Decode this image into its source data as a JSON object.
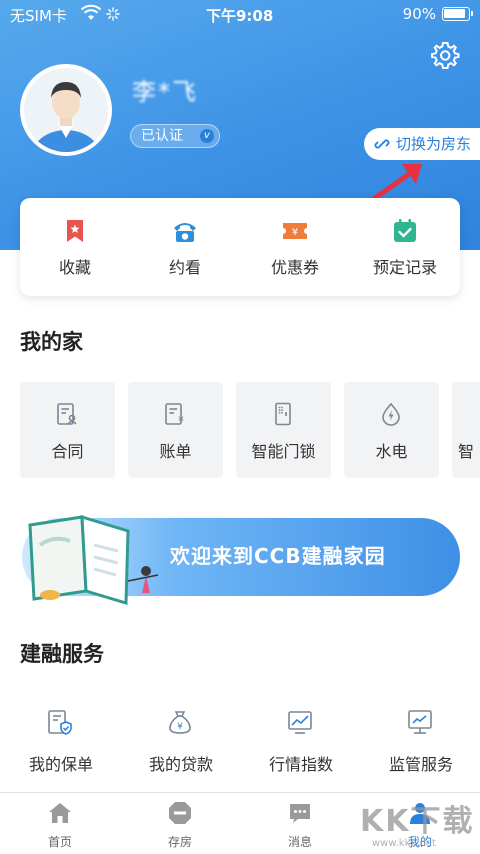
{
  "status_bar": {
    "carrier": "无SIM卡",
    "time": "下午9:08",
    "battery": "90%",
    "battery_level": 0.9
  },
  "profile": {
    "name": "李*飞",
    "verified_label": "已认证",
    "verified_badge": "v"
  },
  "switch_button": {
    "label": "切换为房东"
  },
  "quick_actions": [
    {
      "label": "收藏",
      "icon": "bookmark-icon",
      "color": "#e9544f"
    },
    {
      "label": "约看",
      "icon": "phone-icon",
      "color": "#2f8fd8"
    },
    {
      "label": "优惠券",
      "icon": "coupon-icon",
      "color": "#f07c3a"
    },
    {
      "label": "预定记录",
      "icon": "calendar-check-icon",
      "color": "#2fb58f"
    }
  ],
  "my_home": {
    "title": "我的家",
    "items": [
      {
        "label": "合同",
        "icon": "contract-icon"
      },
      {
        "label": "账单",
        "icon": "bill-icon"
      },
      {
        "label": "智能门锁",
        "icon": "smart-lock-icon"
      },
      {
        "label": "水电",
        "icon": "water-electric-icon"
      },
      {
        "label": "智",
        "icon": "smart-icon"
      }
    ]
  },
  "banner": {
    "text": "欢迎来到CCB建融家园"
  },
  "services": {
    "title": "建融服务",
    "items": [
      {
        "label": "我的保单",
        "icon": "policy-icon"
      },
      {
        "label": "我的贷款",
        "icon": "loan-icon"
      },
      {
        "label": "行情指数",
        "icon": "market-index-icon"
      },
      {
        "label": "监管服务",
        "icon": "supervision-icon"
      }
    ]
  },
  "tab_bar": [
    {
      "label": "首页",
      "icon": "home-icon",
      "active": false
    },
    {
      "label": "存房",
      "icon": "deposit-house-icon",
      "active": false
    },
    {
      "label": "消息",
      "icon": "message-icon",
      "active": false
    },
    {
      "label": "我的",
      "icon": "user-icon",
      "active": true
    }
  ],
  "watermark": {
    "text": "KK下载",
    "sub": "www.kkx.net"
  },
  "colors": {
    "primary": "#2a80db",
    "hero_start": "#57a9ec",
    "hero_end": "#2f83dd",
    "arrow": "#e8303f"
  }
}
